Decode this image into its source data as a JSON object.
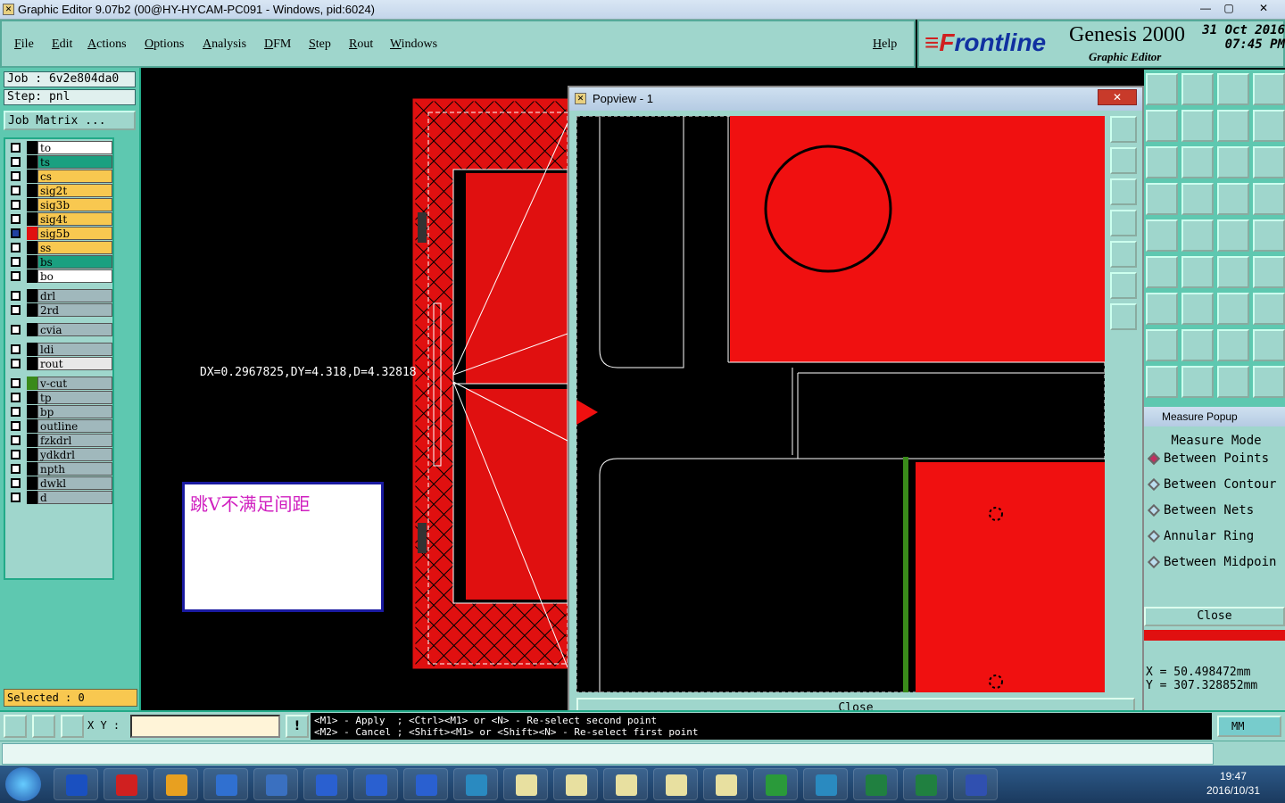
{
  "window": {
    "title": "Graphic Editor 9.07b2 (00@HY-HYCAM-PC091 - Windows, pid:6024)",
    "min_label": "—",
    "max_label": "▢",
    "close_label": "✕"
  },
  "menu": {
    "items": [
      "File",
      "Edit",
      "Actions",
      "Options",
      "Analysis",
      "DFM",
      "Step",
      "Rout",
      "Windows"
    ],
    "help": "Help"
  },
  "brand": {
    "logo_prefix": "≡F",
    "logo_rest": "rontline",
    "product": "Genesis 2000",
    "subtitle": "Graphic Editor",
    "date": "31 Oct 2016",
    "time": "07:45 PM"
  },
  "left": {
    "job": "Job : 6v2e804da0",
    "step": "Step: pnl",
    "job_matrix": "Job Matrix ...",
    "layers": [
      {
        "name": "to",
        "color": "#ffffff"
      },
      {
        "name": "ts",
        "color": "#1aa080"
      },
      {
        "name": "cs",
        "color": "#f8c850"
      },
      {
        "name": "sig2t",
        "color": "#f8c850"
      },
      {
        "name": "sig3b",
        "color": "#f8c850"
      },
      {
        "name": "sig4t",
        "color": "#f8c850"
      },
      {
        "name": "sig5b",
        "color": "#f8c850"
      },
      {
        "name": "ss",
        "color": "#f8c850"
      },
      {
        "name": "bs",
        "color": "#1aa080"
      },
      {
        "name": "bo",
        "color": "#ffffff"
      },
      {
        "name": "drl",
        "color": "#a0b8bc"
      },
      {
        "name": "2rd",
        "color": "#a0b8bc"
      },
      {
        "name": "cvia",
        "color": "#a0b8bc"
      },
      {
        "name": "ldi",
        "color": "#a0b8bc"
      },
      {
        "name": "rout",
        "color": "#e8e8e8"
      },
      {
        "name": "v-cut",
        "color": "#a0b8bc"
      },
      {
        "name": "tp",
        "color": "#a0b8bc"
      },
      {
        "name": "bp",
        "color": "#a0b8bc"
      },
      {
        "name": "outline",
        "color": "#a0b8bc"
      },
      {
        "name": "fzkdrl",
        "color": "#a0b8bc"
      },
      {
        "name": "ydkdrl",
        "color": "#a0b8bc"
      },
      {
        "name": "npth",
        "color": "#a0b8bc"
      },
      {
        "name": "dwkl",
        "color": "#a0b8bc"
      },
      {
        "name": "d",
        "color": "#a0b8bc"
      }
    ],
    "selected": "Selected : 0"
  },
  "canvas": {
    "measure_text": "DX=0.2967825,DY=4.318,D=4.32818",
    "note": "跳V不满足间距"
  },
  "popview": {
    "title": "Popview - 1",
    "close_x": "✕",
    "close": "Close"
  },
  "measure": {
    "title": "Measure Popup",
    "mode_label": "Measure Mode",
    "options": [
      "Between Points",
      "Between Contour",
      "Between Nets",
      "Annular Ring",
      "Between Midpoin"
    ],
    "close": "Close",
    "x": "X =  50.498472mm",
    "y": "Y = 307.328852mm"
  },
  "bottom": {
    "xy_label": "X Y :",
    "hint": "<M1> - Apply  ; <Ctrl><M1> or <N> - Re-select second point\n<M2> - Cancel ; <Shift><M1> or <Shift><N> - Re-select first point",
    "units": "MM"
  },
  "taskbar": {
    "time": "19:47",
    "date": "2016/10/31"
  }
}
